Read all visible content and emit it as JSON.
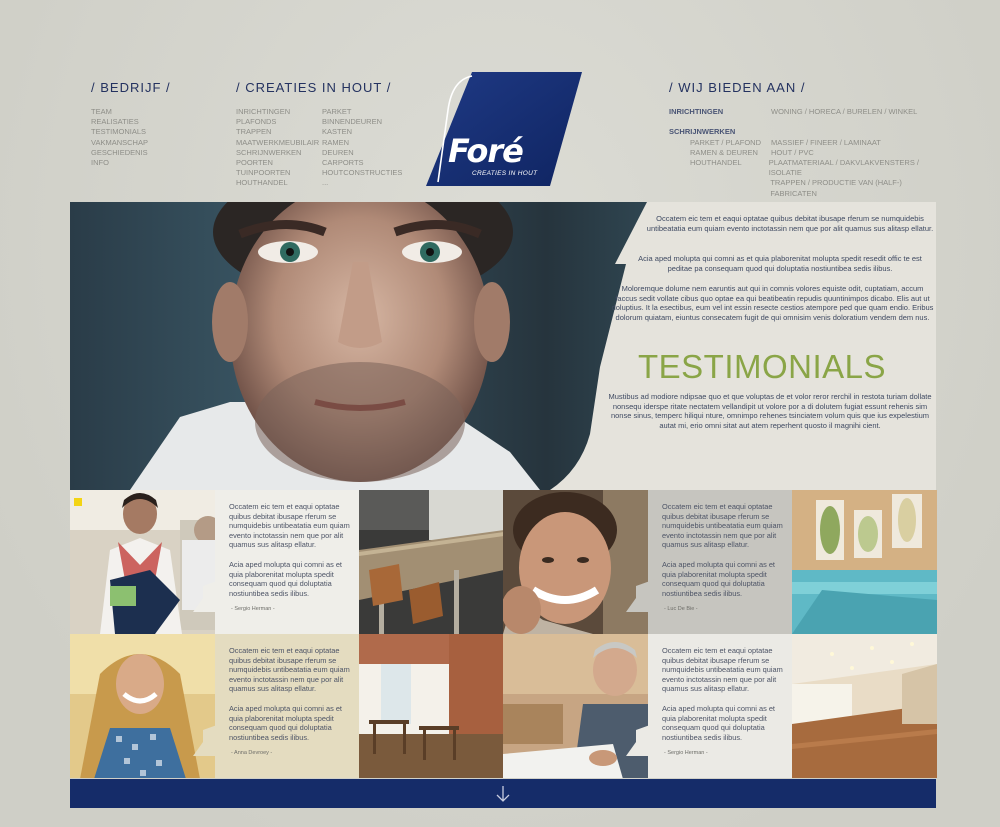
{
  "nav": {
    "bedrijf": {
      "heading": "/ BEDRIJF /",
      "items": [
        "TEAM",
        "REALISATIES",
        "TESTIMONIALS",
        "VAKMANSCHAP",
        "GESCHIEDENIS",
        "INFO"
      ]
    },
    "creaties": {
      "heading": "/ CREATIES IN HOUT /",
      "col1": [
        "INRICHTINGEN",
        "PLAFONDS",
        "TRAPPEN",
        "MAATWERKMEUBILAIR",
        "SCHRIJNWERKEN",
        "POORTEN",
        "TUINPOORTEN",
        "HOUTHANDEL"
      ],
      "col2": [
        "PARKET",
        "BINNENDEUREN",
        "KASTEN",
        "RAMEN",
        "DEUREN",
        "CARPORTS",
        "HOUTCONSTRUCTIES",
        "..."
      ]
    },
    "bieden": {
      "heading": "/ WIJ BIEDEN AAN /",
      "rows": [
        {
          "label": "INRICHTINGEN",
          "value": "WONING  /  HORECA  /  BURELEN  /  WINKEL",
          "sub": false
        },
        {
          "label": "",
          "value": "",
          "sub": false
        },
        {
          "label": "SCHRIJNWERKEN",
          "value": "",
          "sub": false
        },
        {
          "label": "PARKET / PLAFOND",
          "value": "MASSIEF  /  FINEER  /  LAMINAAT",
          "sub": true
        },
        {
          "label": "RAMEN & DEUREN",
          "value": "HOUT  /  PVC",
          "sub": true
        },
        {
          "label": "HOUTHANDEL",
          "value": "PLAATMATERIAAL  /  DAKVLAKVENSTERS  /  ISOLATIE",
          "sub": true
        },
        {
          "label": "",
          "value": "TRAPPEN  /  PRODUCTIE VAN (HALF-) FABRICATEN",
          "sub": true
        }
      ]
    }
  },
  "logo": {
    "word": "Foré",
    "tagline": "CREATIES IN HOUT"
  },
  "hero": {
    "p1": "Occatem eic tem et eaqui optatae quibus debitat ibusape rferum se numquidebis untibeatatia eum quiam evento inctotassin nem que por alit quamus sus alitasp ellatur.",
    "p2": "Acia aped molupta qui comni as et quia plaborenitat molupta spedit resedit offic te est peditae pa consequam quod qui doluptatia nostiuntibea sedis ilibus.",
    "p3": "Moloremque dolume nem earuntis aut qui in comnis volores equiste odit, cuptatiam, accum faccus sedit vollate cibus quo optae ea qui beatibeatin repudis quuntinimpos dicabo. Elis aut ut doluptius. It la esectibus, eum vel int essin resecte cestios atempore ped que quam endio. Eribus dolorum quiatam, eiuntus consecatem fugit de qui omnisim venis doloratium vendem dem nus.",
    "title": "TESTIMONIALS",
    "p4": "Mustibus ad modiore ndipsae quo et que voluptas de et volor reror rerchil in restota turiam dollate nonsequ iderspe ritate nectatem vellandipit ut volore por a di dolutem fugiat essunt rehenis sim nonse sinus, temperc hiliqui nture, omnimpo rehenes tsinciatem volum quis que ius expelestium autat mi, erio omni sitat aut atem reperhent quosto il magnihi cient."
  },
  "quotes": [
    {
      "p1": "Occatem eic tem et eaqui optatae quibus debitat ibusape rferum se numquidebis untibeatatia eum quiam evento inctotassin nem que por alit quamus sus alitasp ellatur.",
      "p2": "Acia aped molupta qui comni as et quia plaborenitat molupta spedit consequam quod qui doluptatia nostiuntibea sedis ilibus.",
      "author": "- Sergio Herman -"
    },
    {
      "p1": "Occatem eic tem et eaqui optatae quibus debitat ibusape rferum se numquidebis untibeatatia eum quiam evento inctotassin nem que por alit quamus sus alitasp ellatur.",
      "p2": "Acia aped molupta qui comni as et quia plaborenitat molupta spedit consequam quod qui doluptatia nostiuntibea sedis ilibus.",
      "author": "- Luc De Bie -"
    },
    {
      "p1": "Occatem eic tem et eaqui optatae quibus debitat ibusape rferum se numquidebis untibeatatia eum quiam evento inctotassin nem que por alit quamus sus alitasp ellatur.",
      "p2": "Acia aped molupta qui comni as et quia plaborenitat molupta spedit consequam quod qui doluptatia nostiuntibea sedis ilibus.",
      "author": "- Anna Devroey -"
    },
    {
      "p1": "Occatem eic tem et eaqui optatae quibus debitat ibusape rferum se numquidebis untibeatatia eum quiam evento inctotassin nem que por alit quamus sus alitasp ellatur.",
      "p2": "Acia aped molupta qui comni as et quia plaborenitat molupta spedit consequam quod qui doluptatia nostiuntibea sedis ilibus.",
      "author": "- Sergio Herman -"
    }
  ],
  "colors": {
    "brand_navy": "#152c69",
    "accent_green": "#8aa547",
    "quote_white": "#efeee9",
    "quote_grey": "#c6c5bf",
    "quote_beige": "#e4dcc0",
    "quote_light": "#ebeae5"
  },
  "footer": {
    "icon": "arrow-down-icon"
  }
}
